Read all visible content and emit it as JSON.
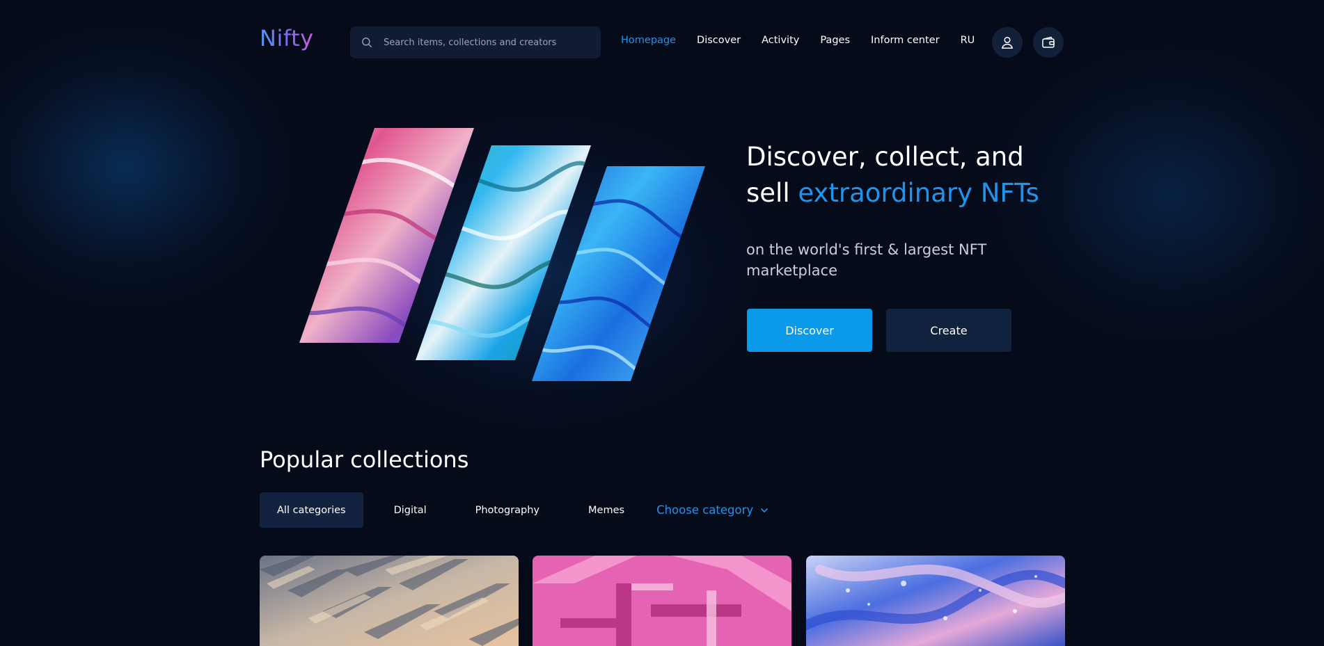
{
  "header": {
    "logo": "Nifty",
    "search_placeholder": "Search items, collections and creators",
    "nav": [
      {
        "label": "Homepage",
        "active": true
      },
      {
        "label": "Discover",
        "active": false
      },
      {
        "label": "Activity",
        "active": false
      },
      {
        "label": "Pages",
        "active": false
      },
      {
        "label": "Inform center",
        "active": false
      },
      {
        "label": "RU",
        "active": false
      }
    ],
    "icons": [
      "user-icon",
      "wallet-icon"
    ]
  },
  "hero": {
    "title_line1": "Discover, collect, and",
    "title_line2_prefix": "sell ",
    "title_line2_accent": "extraordinary NFTs",
    "subtitle": "on the world's first & largest NFT marketplace",
    "primary_button": "Discover",
    "secondary_button": "Create"
  },
  "popular": {
    "title": "Popular collections",
    "categories": [
      {
        "label": "All categories",
        "active": true
      },
      {
        "label": "Digital",
        "active": false
      },
      {
        "label": "Photography",
        "active": false
      },
      {
        "label": "Memes",
        "active": false
      }
    ],
    "choose_label": "Choose category"
  },
  "colors": {
    "background": "#060b1a",
    "accent": "#1e94ee",
    "primary_button": "#0b9aea",
    "secondary_button": "#11223e",
    "search_bg": "#111c33"
  }
}
